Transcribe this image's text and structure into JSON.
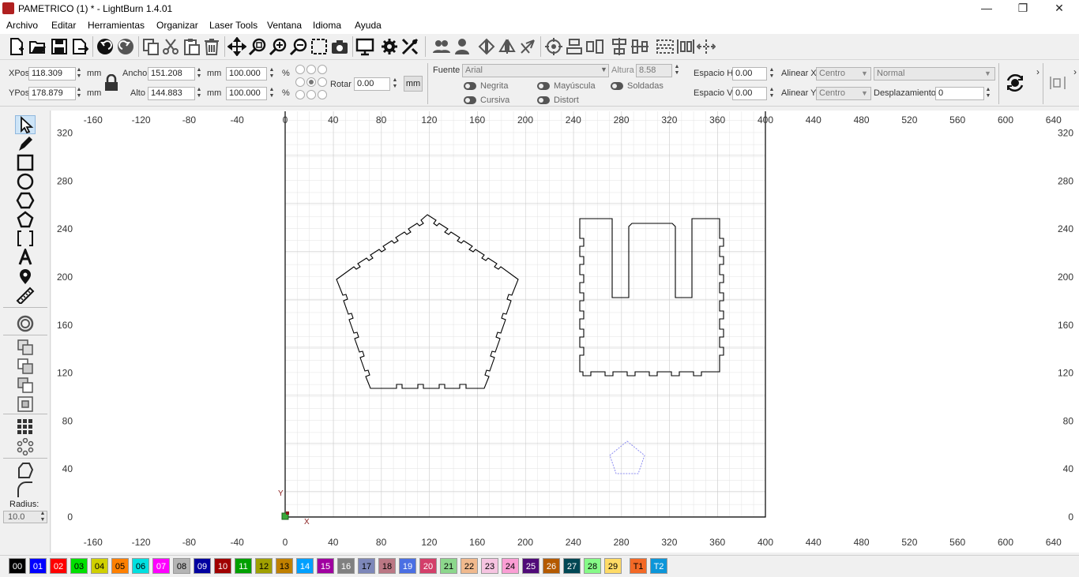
{
  "window": {
    "title": "PAMETRICO (1) * - LightBurn 1.4.01",
    "minimize": "—",
    "maximize": "❐",
    "close": "✕"
  },
  "menu": [
    "Archivo",
    "Editar",
    "Herramientas",
    "Organizar",
    "Laser Tools",
    "Ventana",
    "Idioma",
    "Ayuda"
  ],
  "toolbar_icons": [
    "new-file-icon",
    "open-folder-icon",
    "save-icon",
    "export-icon",
    "undo-icon",
    "redo-icon",
    "copy-icon",
    "cut-icon",
    "paste-icon",
    "delete-icon",
    "move-icon",
    "zoom-fit-icon",
    "zoom-in-icon",
    "zoom-out-icon",
    "select-frame-icon",
    "camera-icon",
    "monitor-icon",
    "settings-icon",
    "tools-icon",
    "group-icon",
    "ungroup-icon",
    "mirror-h-icon",
    "mirror-v-icon",
    "rotate-icon",
    "target-icon",
    "align-left-icon",
    "align-center-icon",
    "distribute-icon",
    "align-right-icon",
    "dock-icon",
    "distribute-h-icon",
    "center-move-icon"
  ],
  "props": {
    "xpos_label": "XPos",
    "xpos_value": "118.309",
    "ypos_label": "YPos",
    "ypos_value": "178.879",
    "mm1": "mm",
    "mm2": "mm",
    "ancho_label": "Ancho",
    "ancho_value": "151.208",
    "alto_label": "Alto",
    "alto_value": "144.883",
    "mm3": "mm",
    "mm4": "mm",
    "pct_w": "100.000",
    "pct_h": "100.000",
    "pct1": "%",
    "pct2": "%",
    "rotar_label": "Rotar",
    "rotar_value": "0.00",
    "unit_button": "mm",
    "fuente_label": "Fuente",
    "fuente_value": "Arial",
    "altura_label": "Altura",
    "altura_value": "8.58",
    "negrita": "Negrita",
    "mayuscula": "Mayúscula",
    "soldadas": "Soldadas",
    "cursiva": "Cursiva",
    "distort": "Distort",
    "espacio_h_label": "Espacio H",
    "espacio_h_value": "0.00",
    "espacio_v_label": "Espacio V",
    "espacio_v_value": "0.00",
    "alinear_x_label": "Alinear X",
    "alinear_x_value": "Centro",
    "alinear_y_label": "Alinear Y",
    "alinear_y_value": "Centro",
    "normal_value": "Normal",
    "desplazamiento_label": "Desplazamiento",
    "desplazamiento_value": "0"
  },
  "tools": [
    "select-arrow-icon",
    "pen-icon",
    "rectangle-icon",
    "ellipse-icon",
    "polygon-icon",
    "pentagon-icon",
    "frame-icon",
    "text-icon",
    "position-marker-icon",
    "measure-icon",
    "offset-icon",
    "weld-icon",
    "union-icon",
    "subtract-icon",
    "intersect-icon",
    "grid-array-icon",
    "circular-array-icon",
    "edit-nodes-icon",
    "corner-icon"
  ],
  "radius": {
    "label": "Radius:",
    "value": "10.0"
  },
  "canvas": {
    "x_ticks": [
      "-160",
      "-120",
      "-80",
      "-40",
      "0",
      "40",
      "80",
      "120",
      "160",
      "200",
      "240",
      "280",
      "320",
      "360",
      "400",
      "440",
      "480",
      "520",
      "560",
      "600",
      "640"
    ],
    "y_ticks": [
      "320",
      "280",
      "240",
      "200",
      "160",
      "120",
      "80",
      "40",
      "0"
    ],
    "axis_x": "X",
    "axis_y": "Y"
  },
  "palette": [
    {
      "label": "00",
      "color": "#000000",
      "text": "#ffffff"
    },
    {
      "label": "01",
      "color": "#0000ff",
      "text": "#ffffff"
    },
    {
      "label": "02",
      "color": "#ff0000",
      "text": "#ffffff"
    },
    {
      "label": "03",
      "color": "#00e000",
      "text": "#000000"
    },
    {
      "label": "04",
      "color": "#d0d000",
      "text": "#000000"
    },
    {
      "label": "05",
      "color": "#ff8000",
      "text": "#000000"
    },
    {
      "label": "06",
      "color": "#00e0e0",
      "text": "#000000"
    },
    {
      "label": "07",
      "color": "#ff00ff",
      "text": "#ffffff"
    },
    {
      "label": "08",
      "color": "#b4b4b4",
      "text": "#000000"
    },
    {
      "label": "09",
      "color": "#0000a0",
      "text": "#ffffff"
    },
    {
      "label": "10",
      "color": "#a00000",
      "text": "#ffffff"
    },
    {
      "label": "11",
      "color": "#00a000",
      "text": "#ffffff"
    },
    {
      "label": "12",
      "color": "#a0a000",
      "text": "#000000"
    },
    {
      "label": "13",
      "color": "#c08000",
      "text": "#000000"
    },
    {
      "label": "14",
      "color": "#00a0ff",
      "text": "#ffffff"
    },
    {
      "label": "15",
      "color": "#a000a0",
      "text": "#ffffff"
    },
    {
      "label": "16",
      "color": "#808080",
      "text": "#ffffff"
    },
    {
      "label": "17",
      "color": "#7d87b9",
      "text": "#000000"
    },
    {
      "label": "18",
      "color": "#bb7784",
      "text": "#000000"
    },
    {
      "label": "19",
      "color": "#4a6fe3",
      "text": "#ffffff"
    },
    {
      "label": "20",
      "color": "#d33f6a",
      "text": "#ffffff"
    },
    {
      "label": "21",
      "color": "#8cd78c",
      "text": "#000000"
    },
    {
      "label": "22",
      "color": "#f0b98d",
      "text": "#000000"
    },
    {
      "label": "23",
      "color": "#f6c4e1",
      "text": "#000000"
    },
    {
      "label": "24",
      "color": "#fa9ed4",
      "text": "#000000"
    },
    {
      "label": "25",
      "color": "#500a78",
      "text": "#ffffff"
    },
    {
      "label": "26",
      "color": "#b45a00",
      "text": "#ffffff"
    },
    {
      "label": "27",
      "color": "#004754",
      "text": "#ffffff"
    },
    {
      "label": "28",
      "color": "#86fa88",
      "text": "#000000"
    },
    {
      "label": "29",
      "color": "#ffdb66",
      "text": "#000000"
    },
    {
      "label": "T1",
      "color": "#f36926",
      "text": "#000000"
    },
    {
      "label": "T2",
      "color": "#0c96d9",
      "text": "#ffffff"
    }
  ]
}
